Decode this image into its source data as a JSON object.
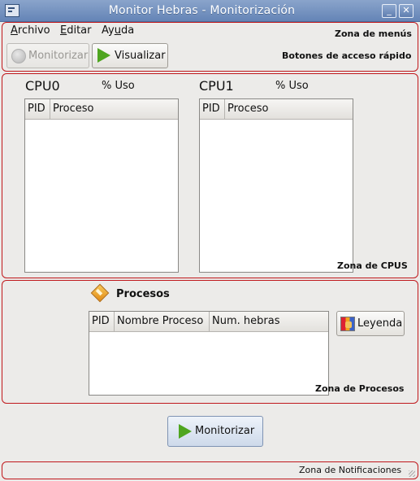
{
  "window": {
    "title": "Monitor Hebras - Monitorización",
    "minimize_glyph": "_",
    "close_glyph": "✕",
    "app_icon": "window-app-icon"
  },
  "menubar": {
    "items": [
      {
        "label": "Archivo",
        "mnemonic_index": 0
      },
      {
        "label": "Editar",
        "mnemonic_index": 0
      },
      {
        "label": "Ayuda",
        "mnemonic_index": 2
      }
    ],
    "zone_label": "Zona de menús"
  },
  "toolbar": {
    "monitorizar_label": "Monitorizar",
    "visualizar_label": "Visualizar",
    "zone_label": "Botones de acceso rápido"
  },
  "cpus": {
    "zone_label": "Zona de CPUS",
    "items": [
      {
        "name": "CPU0",
        "usage_label": "% Uso",
        "columns": [
          "PID",
          "Proceso"
        ]
      },
      {
        "name": "CPU1",
        "usage_label": "% Uso",
        "columns": [
          "PID",
          "Proceso"
        ]
      }
    ]
  },
  "procesos": {
    "title": "Procesos",
    "columns": [
      "PID",
      "Nombre Proceso",
      "Num. hebras"
    ],
    "legend_button": "Leyenda",
    "zone_label": "Zona de Procesos"
  },
  "actions": {
    "monitorizar_label": "Monitorizar"
  },
  "notifications": {
    "zone_label": "Zona de Notificaciones"
  },
  "colors": {
    "zone_border": "#c0181c",
    "title_bar": "#7592c0",
    "window_bg": "#ecebe9",
    "play_icon": "#4ea51f"
  }
}
